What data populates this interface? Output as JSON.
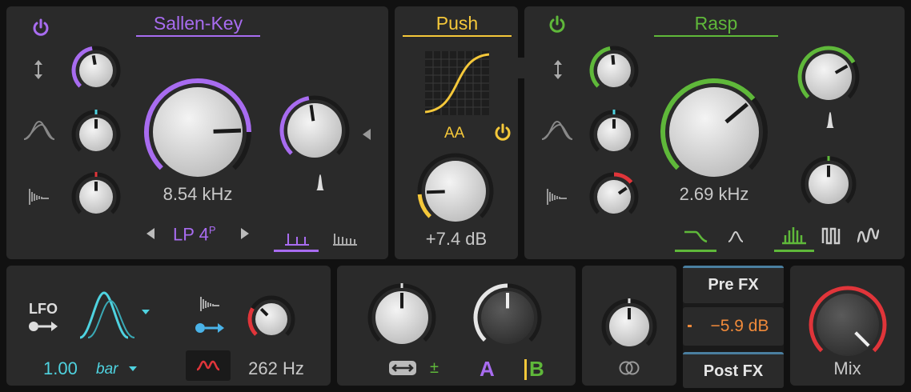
{
  "accent": {
    "purple": "#a86cf0",
    "yellow": "#f5c83a",
    "green": "#5fb83a",
    "cyan": "#4fd3e0",
    "orange": "#f08a3a",
    "red": "#e0353a"
  },
  "filter1": {
    "title": "Sallen-Key",
    "frequency": "8.54 kHz",
    "mode": "LP 4",
    "mode_superscript": "P",
    "prev_icon": "triangle-left-icon",
    "next_icon": "triangle-right-icon"
  },
  "drive": {
    "title": "Push",
    "aa_label": "AA",
    "gain": "+7.4 dB"
  },
  "filter2": {
    "title": "Rasp",
    "frequency": "2.69 kHz"
  },
  "modulator": {
    "lfo_label": "LFO",
    "rate": "1.00",
    "unit": "bar",
    "frequency": "262 Hz"
  },
  "ab": {
    "a": "A",
    "b": "B",
    "pm": "±"
  },
  "output": {
    "pre_fx": "Pre FX",
    "level": "−5.9 dB",
    "post_fx": "Post FX",
    "mix": "Mix"
  }
}
